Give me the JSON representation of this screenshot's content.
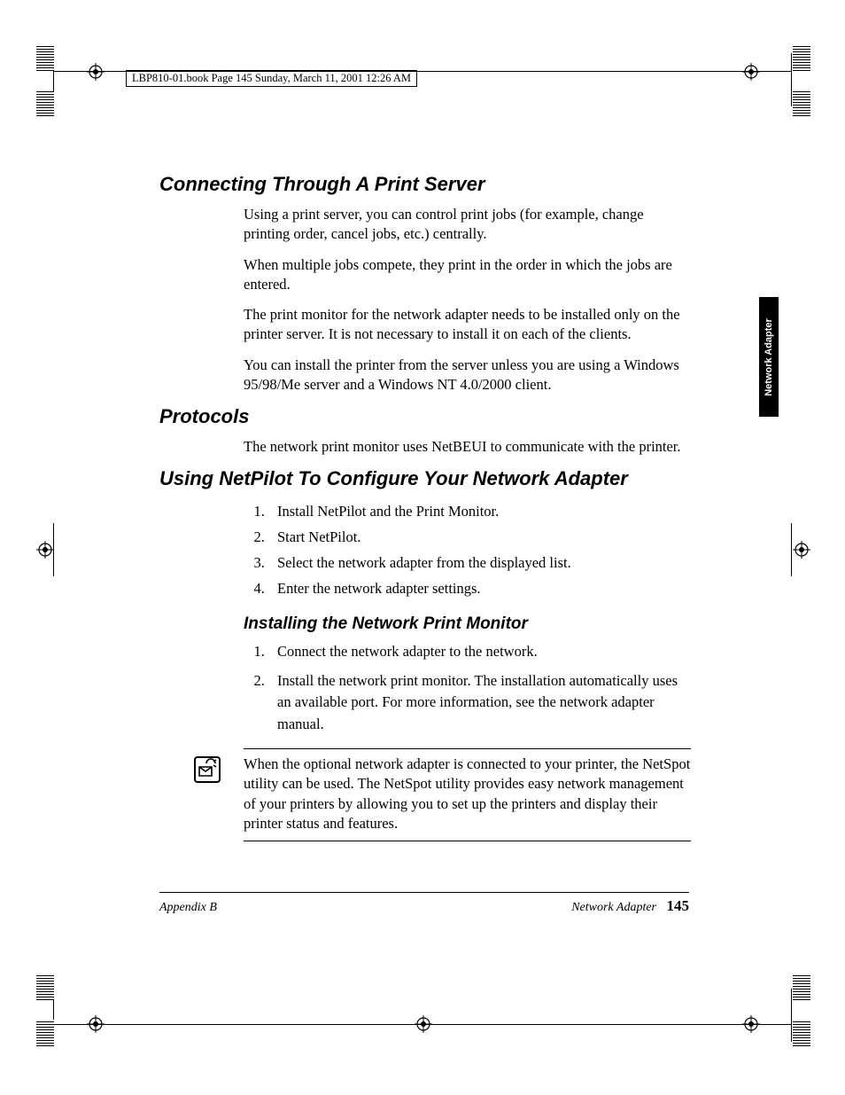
{
  "meta_line": "LBP810-01.book  Page 145  Sunday, March 11, 2001  12:26 AM",
  "sidetab": "Network Adapter",
  "s1": {
    "h": "Connecting Through A Print Server",
    "p1": "Using a print server, you can control print jobs (for example, change printing order, cancel jobs, etc.) centrally.",
    "p2": "When multiple jobs compete, they print in the order in which the jobs are entered.",
    "p3": "The print monitor for the network adapter needs to be installed only on the printer server. It is not necessary to install it on each of the clients.",
    "p4": "You can install the printer from the server unless you are using a Windows 95/98/Me server and a Windows NT 4.0/2000 client."
  },
  "s2": {
    "h": "Protocols",
    "p1": "The network print monitor uses NetBEUI to communicate with the printer."
  },
  "s3": {
    "h": "Using NetPilot To Configure Your Network Adapter",
    "li1": "Install NetPilot and the Print Monitor.",
    "li2": "Start NetPilot.",
    "li3": "Select the network adapter from the displayed list.",
    "li4": "Enter the network adapter settings.",
    "sub": "Installing the Network Print Monitor",
    "sli1": "Connect the network adapter to the network.",
    "sli2": "Install the network print monitor. The installation automatically uses an available port. For more information, see the network adapter manual."
  },
  "note": "When the optional network adapter is connected to your printer, the NetSpot utility can be used. The NetSpot utility provides easy network management of your printers by allowing you to set up the printers and display their printer status and features.",
  "footer": {
    "left": "Appendix B",
    "right_label": "Network Adapter",
    "page": "145"
  }
}
